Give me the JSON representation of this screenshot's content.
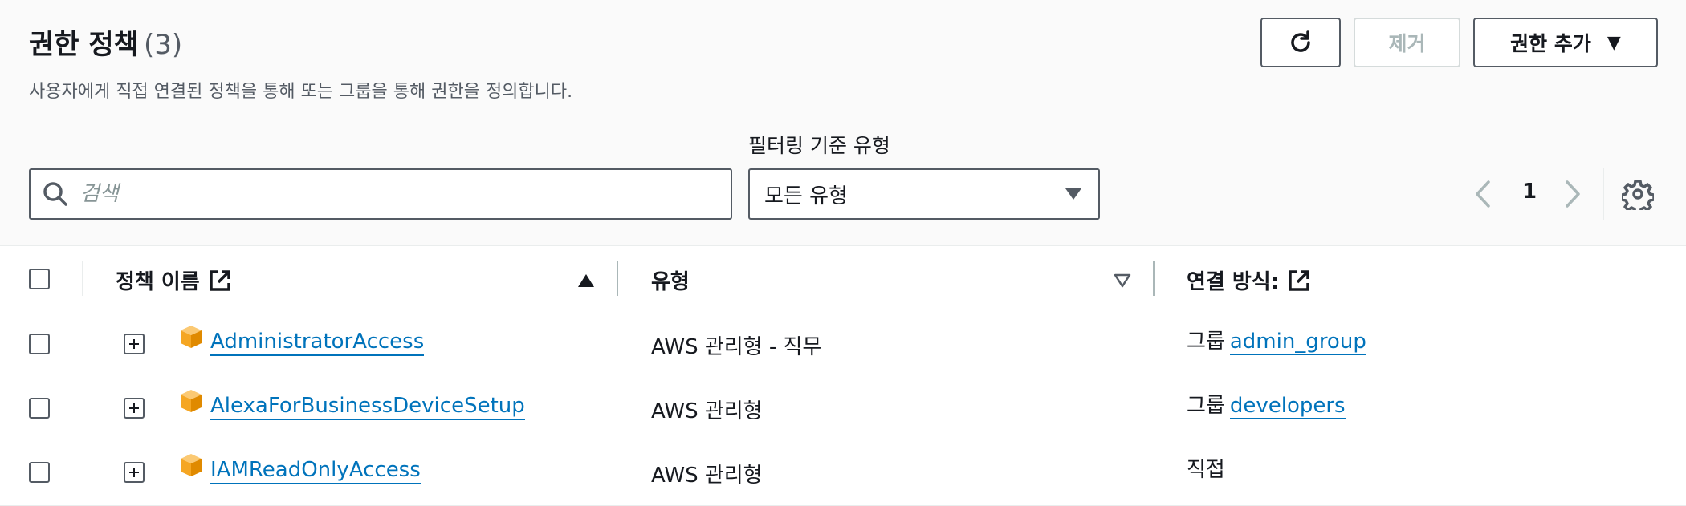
{
  "header": {
    "title": "권한 정책",
    "count": "(3)",
    "description": "사용자에게 직접 연결된 정책을 통해 또는 그룹을 통해 권한을 정의합니다."
  },
  "actions": {
    "refresh_icon": "refresh-icon",
    "remove_label": "제거",
    "add_label": "권한 추가"
  },
  "filter": {
    "search_placeholder": "검색",
    "search_value": "",
    "type_label": "필터링 기준 유형",
    "type_selected": "모든 유형"
  },
  "pagination": {
    "current_page": "1"
  },
  "table": {
    "columns": {
      "name": "정책 이름",
      "type": "유형",
      "attach": "연결 방식:"
    },
    "rows": [
      {
        "name": "AdministratorAccess",
        "type": "AWS 관리형 - 직무",
        "attach_prefix": "그룹",
        "attach_link": "admin_group"
      },
      {
        "name": "AlexaForBusinessDeviceSetup",
        "type": "AWS 관리형",
        "attach_prefix": "그룹",
        "attach_link": "developers"
      },
      {
        "name": "IAMReadOnlyAccess",
        "type": "AWS 관리형",
        "attach_prefix": "직접",
        "attach_link": ""
      }
    ]
  },
  "colors": {
    "link": "#0073bb",
    "border": "#545b64",
    "disabled": "#aab7b8",
    "cube_orange": "#f5a623"
  }
}
